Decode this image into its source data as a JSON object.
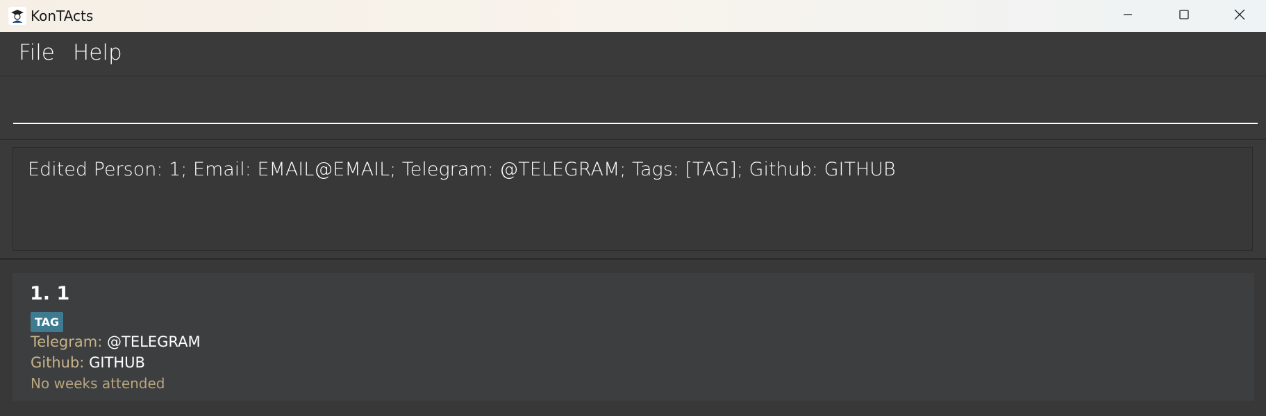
{
  "window": {
    "title": "KonTActs"
  },
  "menu": {
    "items": [
      {
        "label": "File"
      },
      {
        "label": "Help"
      }
    ]
  },
  "command": {
    "value": "",
    "placeholder": ""
  },
  "result": {
    "message": "Edited Person: 1; Email: EMAIL@EMAIL; Telegram: @TELEGRAM; Tags: [TAG]; Github: GITHUB"
  },
  "persons": [
    {
      "heading": "1. 1",
      "tags": [
        "TAG"
      ],
      "telegram_label": "Telegram:",
      "telegram_value": "@TELEGRAM",
      "github_label": "Github:",
      "github_value": "GITHUB",
      "attendance": "No weeks attended"
    }
  ],
  "colors": {
    "background": "#3a3a3a",
    "card": "#3c3e3f",
    "tag": "#3e7b91",
    "field_label": "#c9b48a"
  },
  "icons": {
    "app": "app-logo-icon",
    "minimize": "minimize-icon",
    "maximize": "maximize-icon",
    "close": "close-icon"
  }
}
